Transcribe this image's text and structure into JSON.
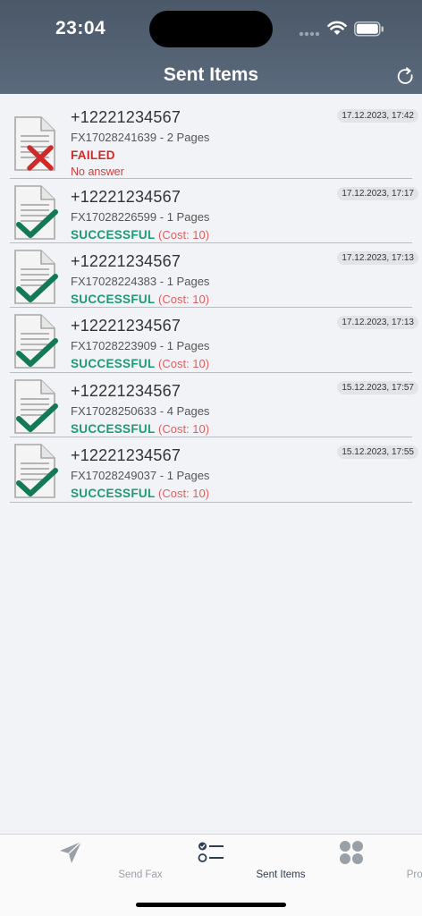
{
  "status_bar": {
    "time": "23:04"
  },
  "header": {
    "title": "Sent Items"
  },
  "items": [
    {
      "phone": "+12221234567",
      "fax_id": "FX17028241639",
      "pages": "2 Pages",
      "status": "FAILED",
      "reason": "No answer",
      "date": "17.12.2023, 17:42"
    },
    {
      "phone": "+12221234567",
      "fax_id": "FX17028226599",
      "pages": "1 Pages",
      "status": "SUCCESSFUL",
      "cost": "(Cost: 10)",
      "date": "17.12.2023, 17:17"
    },
    {
      "phone": "+12221234567",
      "fax_id": "FX17028224383",
      "pages": "1 Pages",
      "status": "SUCCESSFUL",
      "cost": "(Cost: 10)",
      "date": "17.12.2023, 17:13"
    },
    {
      "phone": "+12221234567",
      "fax_id": "FX17028223909",
      "pages": "1 Pages",
      "status": "SUCCESSFUL",
      "cost": "(Cost: 10)",
      "date": "17.12.2023, 17:13"
    },
    {
      "phone": "+12221234567",
      "fax_id": "FX17028250633",
      "pages": "4 Pages",
      "status": "SUCCESSFUL",
      "cost": "(Cost: 10)",
      "date": "15.12.2023, 17:57"
    },
    {
      "phone": "+12221234567",
      "fax_id": "FX17028249037",
      "pages": "1 Pages",
      "status": "SUCCESSFUL",
      "cost": "(Cost: 10)",
      "date": "15.12.2023, 17:55"
    }
  ],
  "tabbar": {
    "tabs": [
      {
        "label": "Send Fax",
        "icon": "paper-plane-icon",
        "active": false
      },
      {
        "label": "Sent Items",
        "icon": "checklist-icon",
        "active": true
      },
      {
        "label": "Profile",
        "icon": "grid-dots-icon",
        "active": false
      }
    ]
  },
  "colors": {
    "header": "#4f5e70",
    "success": "#1f9a72",
    "failed": "#cf2a2a",
    "cost": "#e06060",
    "active_tab": "#2d3e50",
    "inactive_tab": "#9aa0a8"
  }
}
